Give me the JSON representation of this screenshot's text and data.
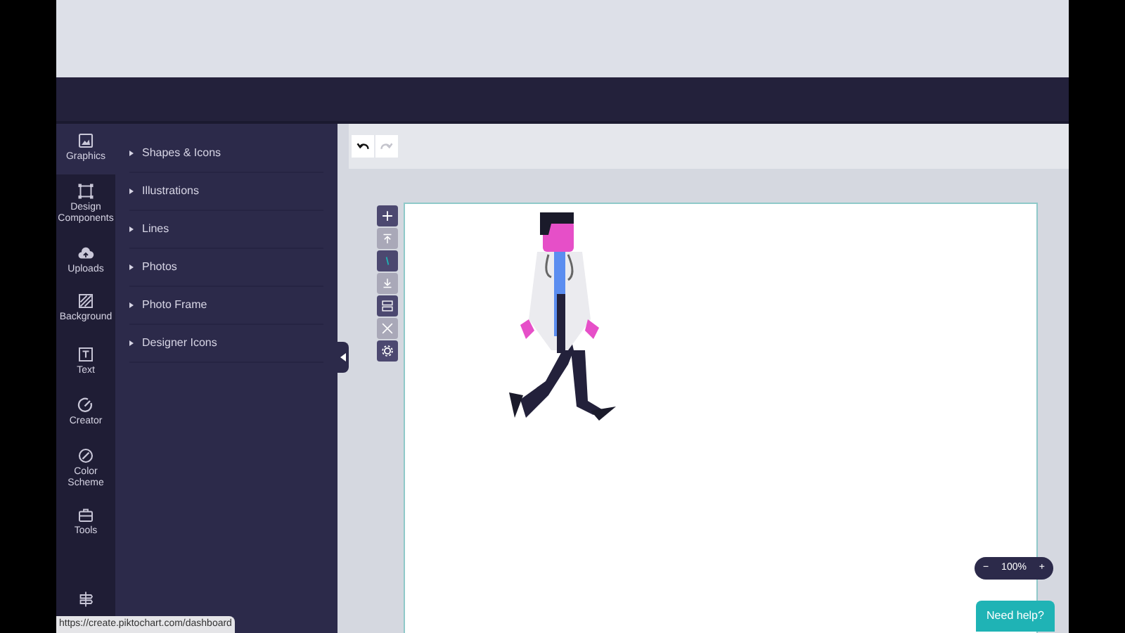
{
  "sidebar": {
    "items": [
      {
        "kind": "graphics",
        "label": "Graphics",
        "selected": true
      },
      {
        "kind": "components",
        "label": "Design Components",
        "selected": false
      },
      {
        "kind": "uploads",
        "label": "Uploads",
        "selected": false
      },
      {
        "kind": "background",
        "label": "Background",
        "selected": false
      },
      {
        "kind": "text",
        "label": "Text",
        "selected": false
      },
      {
        "kind": "creator",
        "label": "Creator",
        "selected": false
      },
      {
        "kind": "color",
        "label": "Color Scheme",
        "selected": false
      },
      {
        "kind": "tools",
        "label": "Tools",
        "selected": false
      },
      {
        "kind": "tour",
        "selected": false
      }
    ]
  },
  "panel": {
    "sections": [
      {
        "label": "Shapes & Icons"
      },
      {
        "label": "Illustrations"
      },
      {
        "label": "Lines"
      },
      {
        "label": "Photos"
      },
      {
        "label": "Photo Frame"
      },
      {
        "label": "Designer Icons"
      }
    ]
  },
  "history": [
    {
      "kind": "undo",
      "disabled": false
    },
    {
      "kind": "redo",
      "disabled": true
    }
  ],
  "canvas_tools": [
    {
      "kind": "plus",
      "disabled": false
    },
    {
      "kind": "up",
      "disabled": true
    },
    {
      "kind": "layer",
      "disabled": false
    },
    {
      "kind": "down",
      "disabled": true
    },
    {
      "kind": "stack",
      "disabled": false
    },
    {
      "kind": "cross",
      "disabled": true
    },
    {
      "kind": "gear",
      "disabled": false
    }
  ],
  "zoom": {
    "minus": "−",
    "reading": "100%",
    "plus": "+"
  },
  "help_button": {
    "label": "Need help?"
  },
  "status_url": "https://create.piktochart.com/dashboard"
}
